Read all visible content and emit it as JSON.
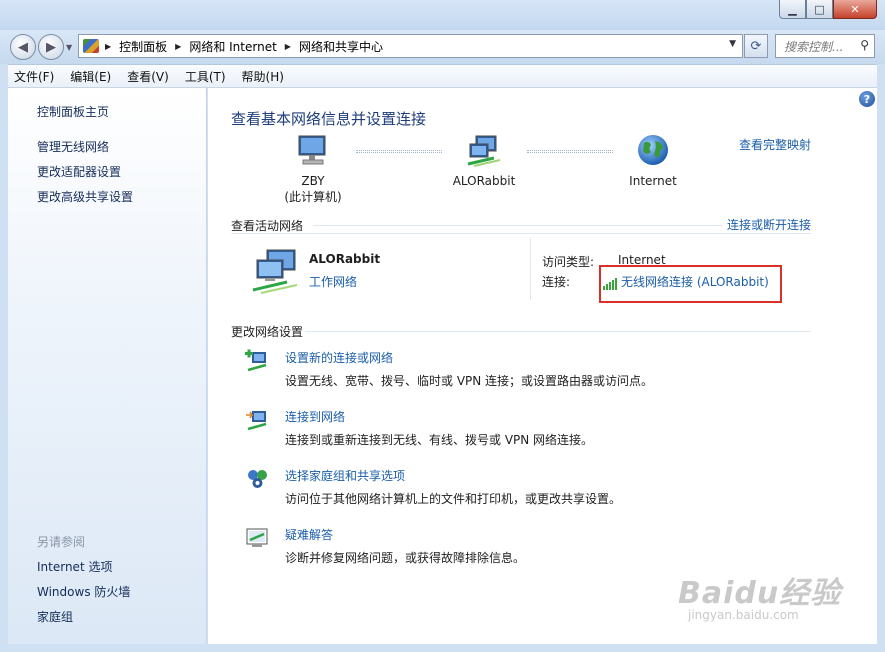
{
  "window": {
    "minimize_glyph": "▁",
    "maximize_glyph": "□",
    "close_glyph": "✕"
  },
  "address": {
    "breadcrumbs": [
      "控制面板",
      "网络和 Internet",
      "网络和共享中心"
    ],
    "search_placeholder": "搜索控制..."
  },
  "menu": [
    "文件(F)",
    "编辑(E)",
    "查看(V)",
    "工具(T)",
    "帮助(H)"
  ],
  "sidebar": {
    "home": "控制面板主页",
    "links": [
      "管理无线网络",
      "更改适配器设置",
      "更改高级共享设置"
    ],
    "see_also_title": "另请参阅",
    "see_also": [
      "Internet 选项",
      "Windows 防火墙",
      "家庭组"
    ]
  },
  "main": {
    "heading": "查看基本网络信息并设置连接",
    "view_full_map": "查看完整映射",
    "nodes": [
      {
        "name": "ZBY",
        "sub": "(此计算机)",
        "icon": "computer-icon"
      },
      {
        "name": "ALORabbit",
        "sub": "",
        "icon": "network-icon"
      },
      {
        "name": "Internet",
        "sub": "",
        "icon": "globe-icon"
      }
    ],
    "active_title": "查看活动网络",
    "connect_disconnect": "连接或断开连接",
    "network": {
      "name": "ALORabbit",
      "type": "工作网络",
      "access_label": "访问类型:",
      "access_value": "Internet",
      "conn_label": "连接:",
      "conn_value": "无线网络连接 (ALORabbit)"
    },
    "change_title": "更改网络设置",
    "tasks": [
      {
        "title": "设置新的连接或网络",
        "desc": "设置无线、宽带、拨号、临时或 VPN 连接；或设置路由器或访问点。",
        "icon": "new-connection-icon"
      },
      {
        "title": "连接到网络",
        "desc": "连接到或重新连接到无线、有线、拨号或 VPN 网络连接。",
        "icon": "connect-network-icon"
      },
      {
        "title": "选择家庭组和共享选项",
        "desc": "访问位于其他网络计算机上的文件和打印机，或更改共享设置。",
        "icon": "homegroup-icon"
      },
      {
        "title": "疑难解答",
        "desc": "诊断并修复网络问题，或获得故障排除信息。",
        "icon": "troubleshoot-icon"
      }
    ]
  },
  "watermark": {
    "main": "Baidu经验",
    "sub": "jingyan.baidu.com"
  },
  "colors": {
    "link": "#1a5ea8",
    "heading": "#1e3d7a",
    "highlight_box": "#d9302a"
  }
}
